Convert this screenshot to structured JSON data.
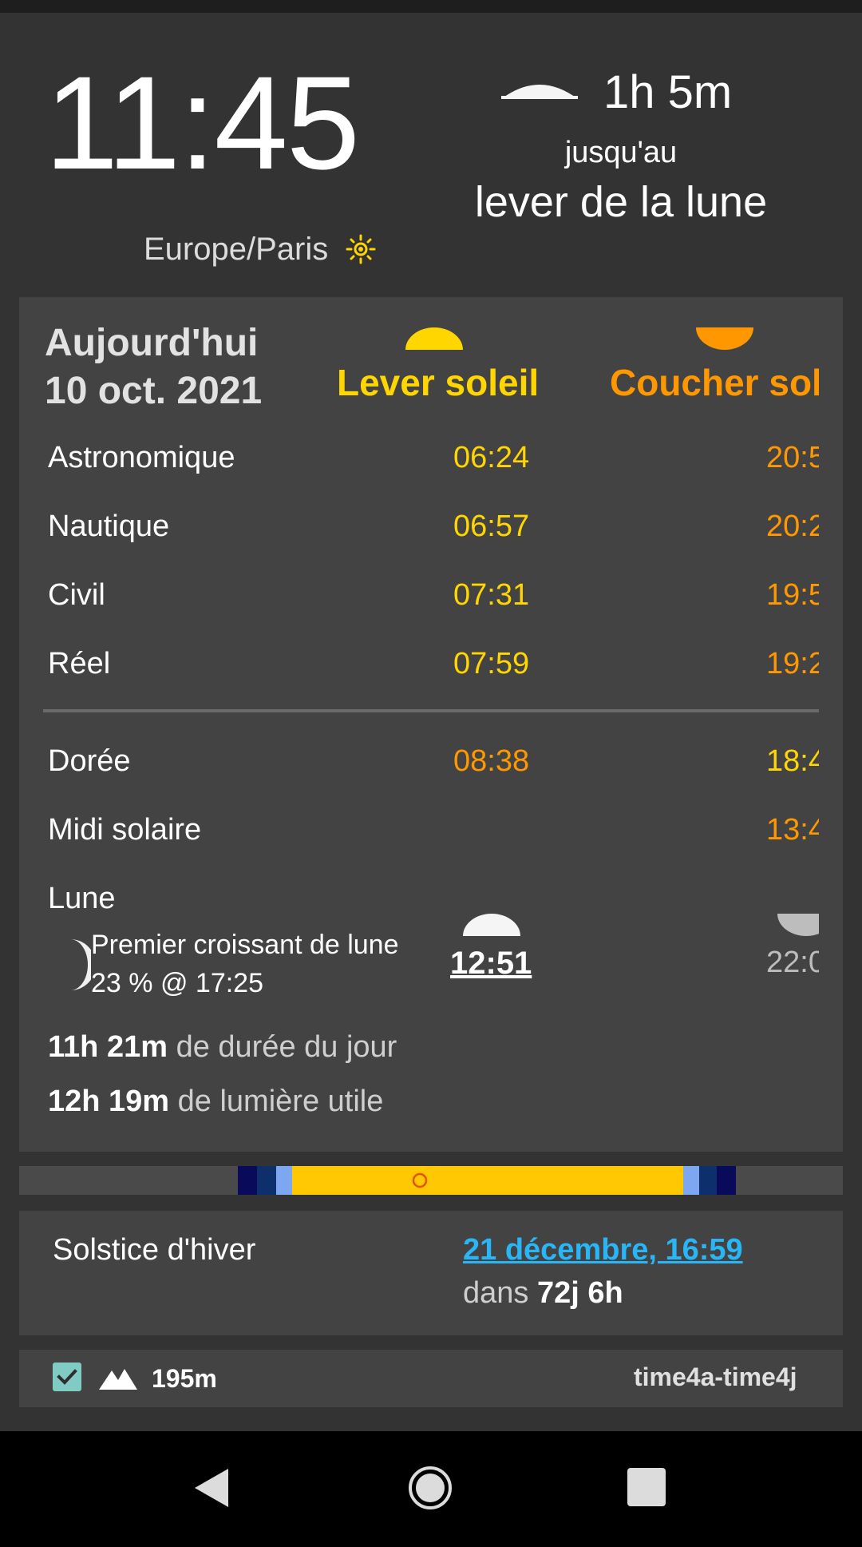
{
  "header": {
    "time": "11:45",
    "timezone": "Europe/Paris",
    "countdown": "1h 5m",
    "until": "jusqu'au",
    "event": "lever de la lune"
  },
  "today": {
    "line1": "Aujourd'hui",
    "line2": "10 oct. 2021",
    "rise_title": "Lever soleil",
    "set_title": "Coucher soleil"
  },
  "rows": [
    {
      "label": "Astronomique",
      "rise": "06:24",
      "set": "20:5"
    },
    {
      "label": "Nautique",
      "rise": "06:57",
      "set": "20:2"
    },
    {
      "label": "Civil",
      "rise": "07:31",
      "set": "19:5"
    },
    {
      "label": "Réel",
      "rise": "07:59",
      "set": "19:2"
    }
  ],
  "golden": {
    "label": "Dorée",
    "rise": "08:38",
    "set": "18:4"
  },
  "noon": {
    "label": "Midi solaire",
    "set": "13:4"
  },
  "moon": {
    "label": "Lune",
    "phase": "Premier croissant de lune",
    "illumination": "23 % @ 17:25",
    "rise": "12:51",
    "set": "22:0"
  },
  "daylight": {
    "day_value": "11h 21m",
    "day_text": "de durée du jour",
    "light_value": "12h 19m",
    "light_text": "de lumière utile"
  },
  "solstice": {
    "label": "Solstice d'hiver",
    "date": "21 décembre, 16:59",
    "in_text": "dans",
    "in_value": "72j 6h"
  },
  "footer": {
    "elevation": "195m",
    "provider": "time4a-time4j"
  },
  "colors": {
    "sunrise": "#ffd600",
    "sunset": "#ff9800",
    "link": "#29b6f6",
    "background": "#333333",
    "card": "#434343"
  }
}
